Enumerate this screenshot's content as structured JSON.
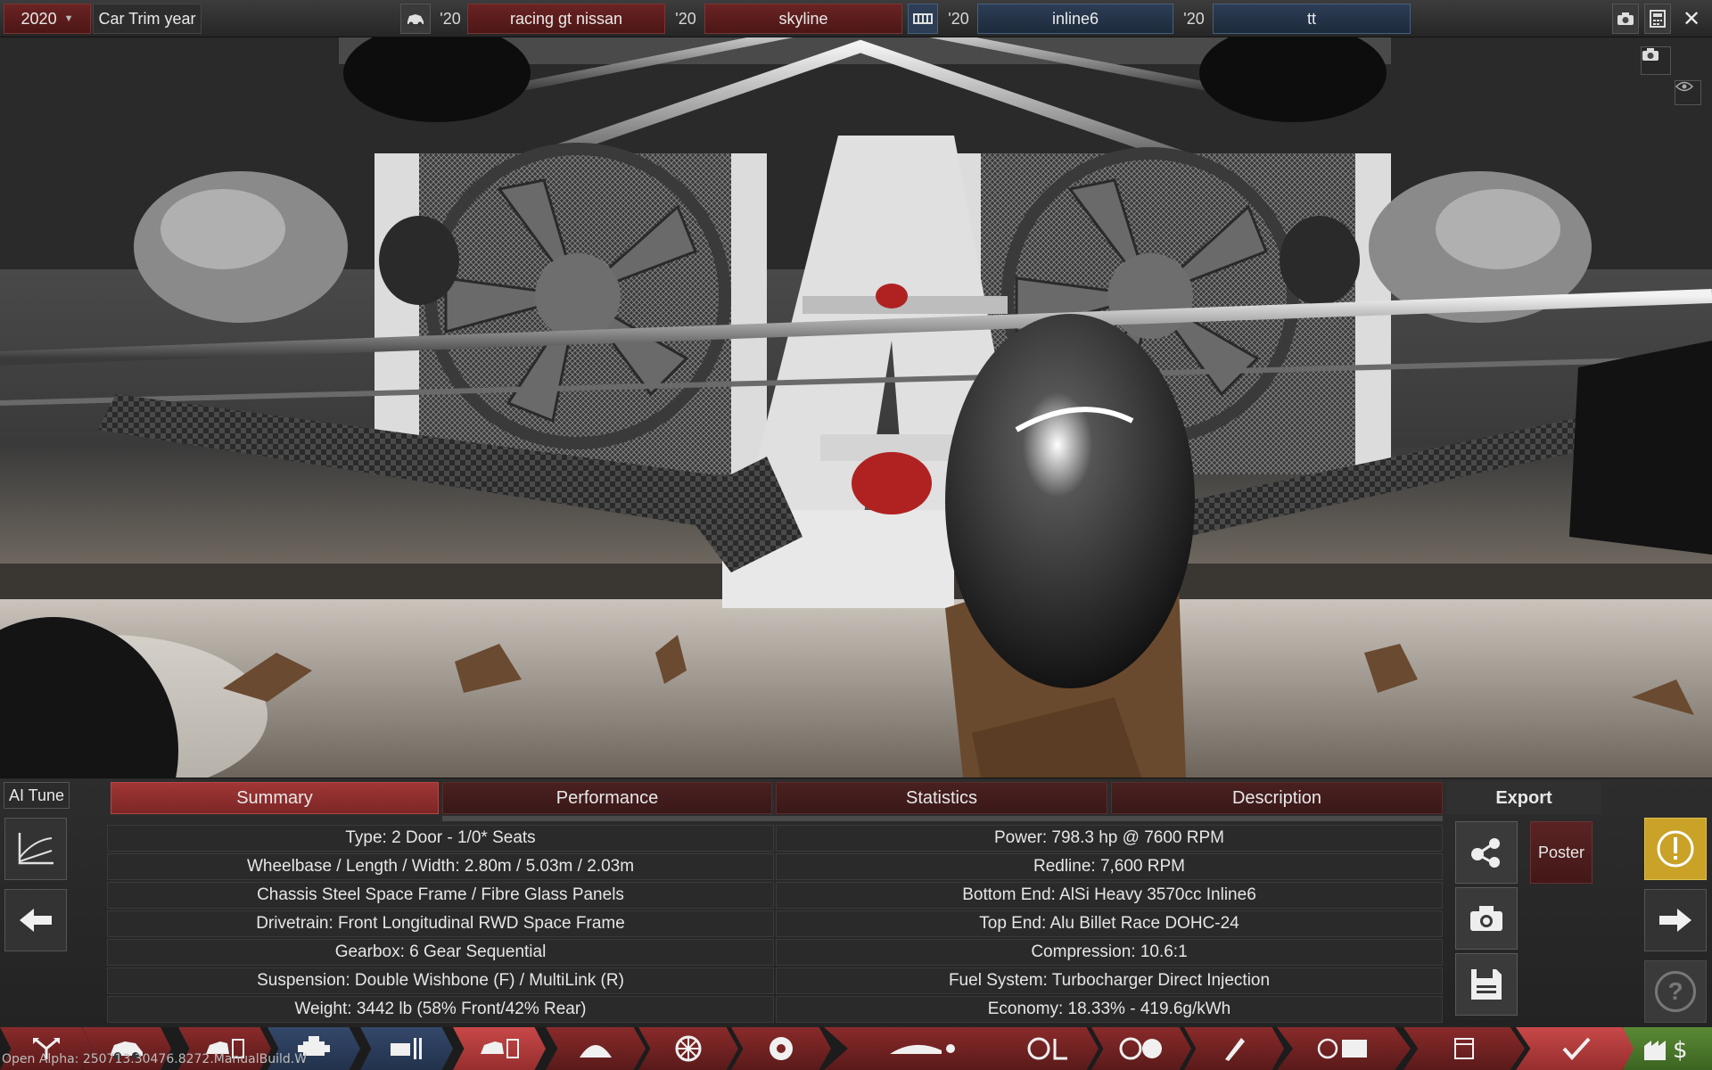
{
  "topbar": {
    "year": "2020",
    "year_caret": "▼",
    "trim_label": "Car Trim year",
    "model_year": "'20",
    "model_name": "racing gt nissan",
    "trim_year": "'20",
    "trim_name": "skyline",
    "engine_year": "'20",
    "engine_family": "inline6",
    "variant_year": "'20",
    "variant_name": "tt",
    "close_glyph": "✕"
  },
  "panel": {
    "ai_tune": "AI Tune",
    "tabs": [
      "Summary",
      "Performance",
      "Statistics",
      "Description"
    ],
    "active_tab": "Summary",
    "summary_left": [
      "Type: 2 Door - 1/0* Seats",
      "Wheelbase / Length / Width: 2.80m / 5.03m / 2.03m",
      "Chassis Steel Space Frame / Fibre Glass Panels",
      "Drivetrain: Front Longitudinal RWD Space Frame",
      "Gearbox: 6 Gear Sequential",
      "Suspension: Double Wishbone (F) / MultiLink (R)",
      "Weight: 3442 lb (58% Front/42% Rear)"
    ],
    "summary_right": [
      "Power: 798.3 hp @ 7600 RPM",
      "Redline:  7,600 RPM",
      "Bottom End: AlSi Heavy 3570cc Inline6",
      "Top End: Alu Billet Race DOHC-24",
      "Compression: 10.6:1",
      "Fuel System: Turbocharger Direct Injection",
      "Economy: 18.33% - 419.6g/kWh"
    ],
    "export_title": "Export",
    "poster_label": "Poster",
    "help_glyph": "?"
  },
  "navbar": {
    "build_label": "Open Alpha: 250713.30476.8272.ManualBuild.W"
  },
  "colors": {
    "accent_red": "#a23636",
    "accent_blue": "#2c3d55",
    "warning_yellow": "#c9a227",
    "confirm_green": "#5a8a34"
  }
}
